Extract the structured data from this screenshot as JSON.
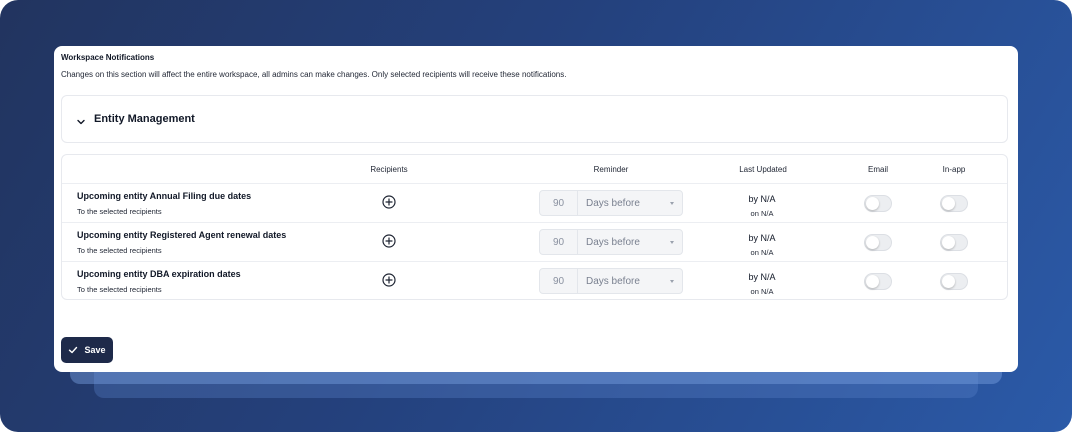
{
  "page": {
    "title": "Workspace Notifications",
    "subtitle": "Changes on this section will affect the entire workspace, all admins can make changes. Only selected recipients will receive these notifications."
  },
  "section": {
    "label": "Entity Management",
    "icon": "chevron-down-icon",
    "expanded": true
  },
  "table": {
    "headers": {
      "recipients": "Recipients",
      "reminder": "Reminder",
      "last_updated": "Last Updated",
      "email": "Email",
      "inapp": "In-app"
    },
    "rows": [
      {
        "title": "Upcoming entity Annual Filing due dates",
        "subtitle": "To the selected recipients",
        "reminder_value": "90",
        "reminder_unit": "Days before",
        "updated_by": "by N/A",
        "updated_on": "on N/A",
        "email_enabled": false,
        "inapp_enabled": false
      },
      {
        "title": "Upcoming entity Registered Agent renewal dates",
        "subtitle": "To the selected recipients",
        "reminder_value": "90",
        "reminder_unit": "Days before",
        "updated_by": "by N/A",
        "updated_on": "on N/A",
        "email_enabled": false,
        "inapp_enabled": false
      },
      {
        "title": "Upcoming entity DBA expiration dates",
        "subtitle": "To the selected recipients",
        "reminder_value": "90",
        "reminder_unit": "Days before",
        "updated_by": "by N/A",
        "updated_on": "on N/A",
        "email_enabled": false,
        "inapp_enabled": false
      }
    ]
  },
  "footer": {
    "save_label": "Save",
    "save_icon": "check-icon"
  },
  "colors": {
    "primary_button": "#1e2a4a",
    "background_gradient_start": "#22345f",
    "background_gradient_end": "#2b5aa8"
  }
}
